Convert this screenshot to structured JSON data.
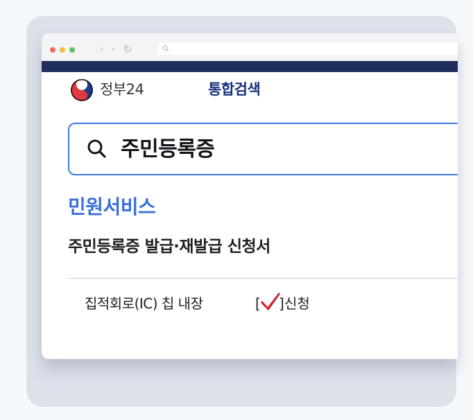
{
  "browser": {
    "window_controls": [
      "close-dot",
      "minimize-dot",
      "maximize-dot"
    ],
    "nav": {
      "back_glyph": "‹",
      "forward_glyph": "›",
      "reload_glyph": "↻"
    },
    "url_bar": {
      "icon": "search-icon",
      "value": ""
    },
    "navbar_color": "#1f2d5c"
  },
  "header": {
    "gov_label": "정부24",
    "search_title": "통합검색",
    "logo_icon": "taegeuk-logo-icon"
  },
  "search": {
    "value": "주민등록증",
    "icon": "search-icon",
    "border_color": "#3c78e0"
  },
  "results": {
    "section_title": "민원서비스",
    "service_title": "주민등록증 발급·재발급 신청서",
    "option": {
      "label": "집적회로(IC) 칩 내장",
      "bracket_open": "[",
      "bracket_close": "]",
      "checked": true,
      "check_icon": "check-mark-icon",
      "apply_label": "신청"
    }
  },
  "colors": {
    "accent": "#3a6fda",
    "brand_navy": "#16307a",
    "check_red": "#d8232a"
  }
}
